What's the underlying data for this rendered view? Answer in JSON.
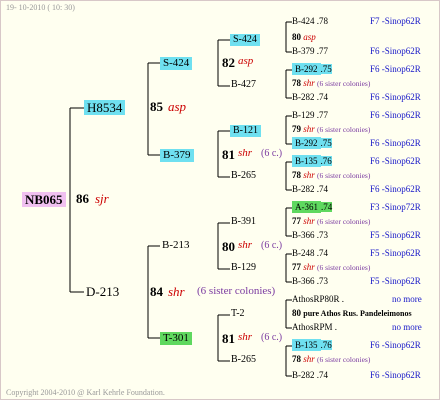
{
  "header": {
    "date": "19- 10-2010 ( 10: 30)"
  },
  "footer": {
    "copyright": "Copyright 2004-2010 @ Karl Kehrle Foundation."
  },
  "root": {
    "id": "NB065",
    "year": "86",
    "tag": "sjr"
  },
  "gen1": {
    "sire": {
      "id": "H8534",
      "year": "85",
      "tag": "asp"
    },
    "dam": {
      "id": "D-213",
      "year": "84",
      "tag": "shr",
      "note": "(6 sister colonies)"
    }
  },
  "gen2": {
    "s424": {
      "id": "S-424",
      "year": "82",
      "tag": "asp"
    },
    "b379": {
      "id": "B-379",
      "year": "81",
      "tag": "shr",
      "note": "(6 c.)"
    },
    "b213": {
      "id": "B-213",
      "year": "80",
      "tag": "shr",
      "note": "(6 c.)"
    },
    "t301": {
      "id": "T-301",
      "year": "81",
      "tag": "shr",
      "note": "(6 c.)"
    }
  },
  "gen3": {
    "s424_a": {
      "id": "S-424"
    },
    "b427": {
      "id": "B-427",
      "year": "78",
      "tag": "shr",
      "note": "(6 sister colonies)"
    },
    "b121": {
      "id": "B-121",
      "year": "79",
      "tag": "shr",
      "note": "(6 sister colonies)"
    },
    "b265_a": {
      "id": "B-265",
      "year": "78",
      "tag": "shr",
      "note": "(6 sister colonies)"
    },
    "b391": {
      "id": "B-391",
      "year": "77",
      "tag": "shr",
      "note": "(6 sister colonies)"
    },
    "b129": {
      "id": "B-129",
      "year": "77",
      "tag": "shr",
      "note": "(6 sister colonies)"
    },
    "t2": {
      "id": "T-2",
      "year": "80",
      "tag": "pure Athos Rus. Pandeleimonos"
    },
    "b265_b": {
      "id": "B-265",
      "year": "78",
      "tag": "shr",
      "note": "(6 sister colonies)"
    }
  },
  "gen4": [
    {
      "id": "B-424",
      "yr": ".78",
      "loc": "F7 -Sinop62R"
    },
    {
      "id": "80",
      "yr": "asp",
      "loc": ""
    },
    {
      "id": "B-379",
      "yr": ".77",
      "loc": "F6 -Sinop62R"
    },
    {
      "id": "B-292",
      "yr": ".75",
      "loc": "F6 -Sinop62R"
    },
    {
      "id": "B-282",
      "yr": ".74",
      "loc": "F6 -Sinop62R"
    },
    {
      "id": "B-129",
      "yr": ".77",
      "loc": "F6 -Sinop62R"
    },
    {
      "id": "B-292",
      "yr": ".75",
      "loc": "F6 -Sinop62R"
    },
    {
      "id": "B-135",
      "yr": ".76",
      "loc": "F6 -Sinop62R"
    },
    {
      "id": "B-282",
      "yr": ".74",
      "loc": "F6 -Sinop62R"
    },
    {
      "id": "A-361",
      "yr": ".74",
      "loc": "F3 -Sinop72R"
    },
    {
      "id": "B-366",
      "yr": ".73",
      "loc": "F5 -Sinop62R"
    },
    {
      "id": "B-248",
      "yr": ".74",
      "loc": "F5 -Sinop62R"
    },
    {
      "id": "B-366",
      "yr": ".73",
      "loc": "F5 -Sinop62R"
    },
    {
      "id": "AthosRP80R",
      "yr": ".",
      "loc": "no more"
    },
    {
      "id": "AthosRPM",
      "yr": ".",
      "loc": "no more"
    },
    {
      "id": "B-135",
      "yr": ".76",
      "loc": "F6 -Sinop62R"
    },
    {
      "id": "B-282",
      "yr": ".74",
      "loc": "F6 -Sinop62R"
    }
  ],
  "colors": {
    "cyan": "#6fe0f0",
    "green": "#5fd85f",
    "pink": "#f0c0f0",
    "blue": "#1818c8",
    "red": "#cc0000",
    "purple": "#7a3aa0"
  }
}
